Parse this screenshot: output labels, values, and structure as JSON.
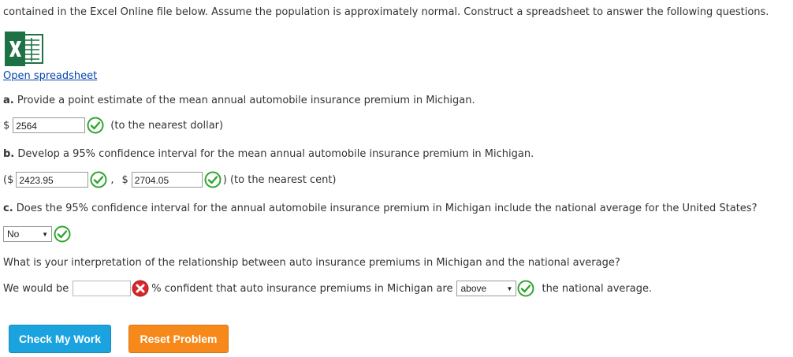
{
  "intro_text": "contained in the Excel Online file below. Assume the population is approximately normal. Construct a spreadsheet to answer the following questions.",
  "excel_icon": "excel-icon",
  "open_link": "Open spreadsheet",
  "qa": {
    "prefix": "a.",
    "text": "Provide a point estimate of the mean annual automobile insurance premium in Michigan.",
    "dollar": "$",
    "value": "2564",
    "note": "(to the nearest dollar)",
    "status": "correct"
  },
  "qb": {
    "prefix": "b.",
    "text": "Develop a 95% confidence interval for the mean annual automobile insurance premium in Michigan.",
    "open": "($",
    "lower": "2423.95",
    "sep": ",",
    "dollar": "$",
    "upper": "2704.05",
    "close": ") (to the nearest cent)"
  },
  "qc": {
    "prefix": "c.",
    "text": "Does the 95% confidence interval for the annual automobile insurance premium in Michigan include the national average for the United States?",
    "select_value": "No"
  },
  "interp": {
    "question": "What is your interpretation of the relationship between auto insurance premiums in Michigan and the national average?",
    "lead": "We would be",
    "confidence_value": "",
    "middle": "% confident that auto insurance premiums in Michigan are",
    "select_value": "above",
    "tail": "the national average."
  },
  "buttons": {
    "check": "Check My Work",
    "reset": "Reset Problem"
  },
  "colors": {
    "correct": "#2fa52f",
    "incorrect": "#d9262b",
    "check_btn": "#1ba3e0",
    "reset_btn": "#f7891a",
    "link": "#0645ad"
  }
}
